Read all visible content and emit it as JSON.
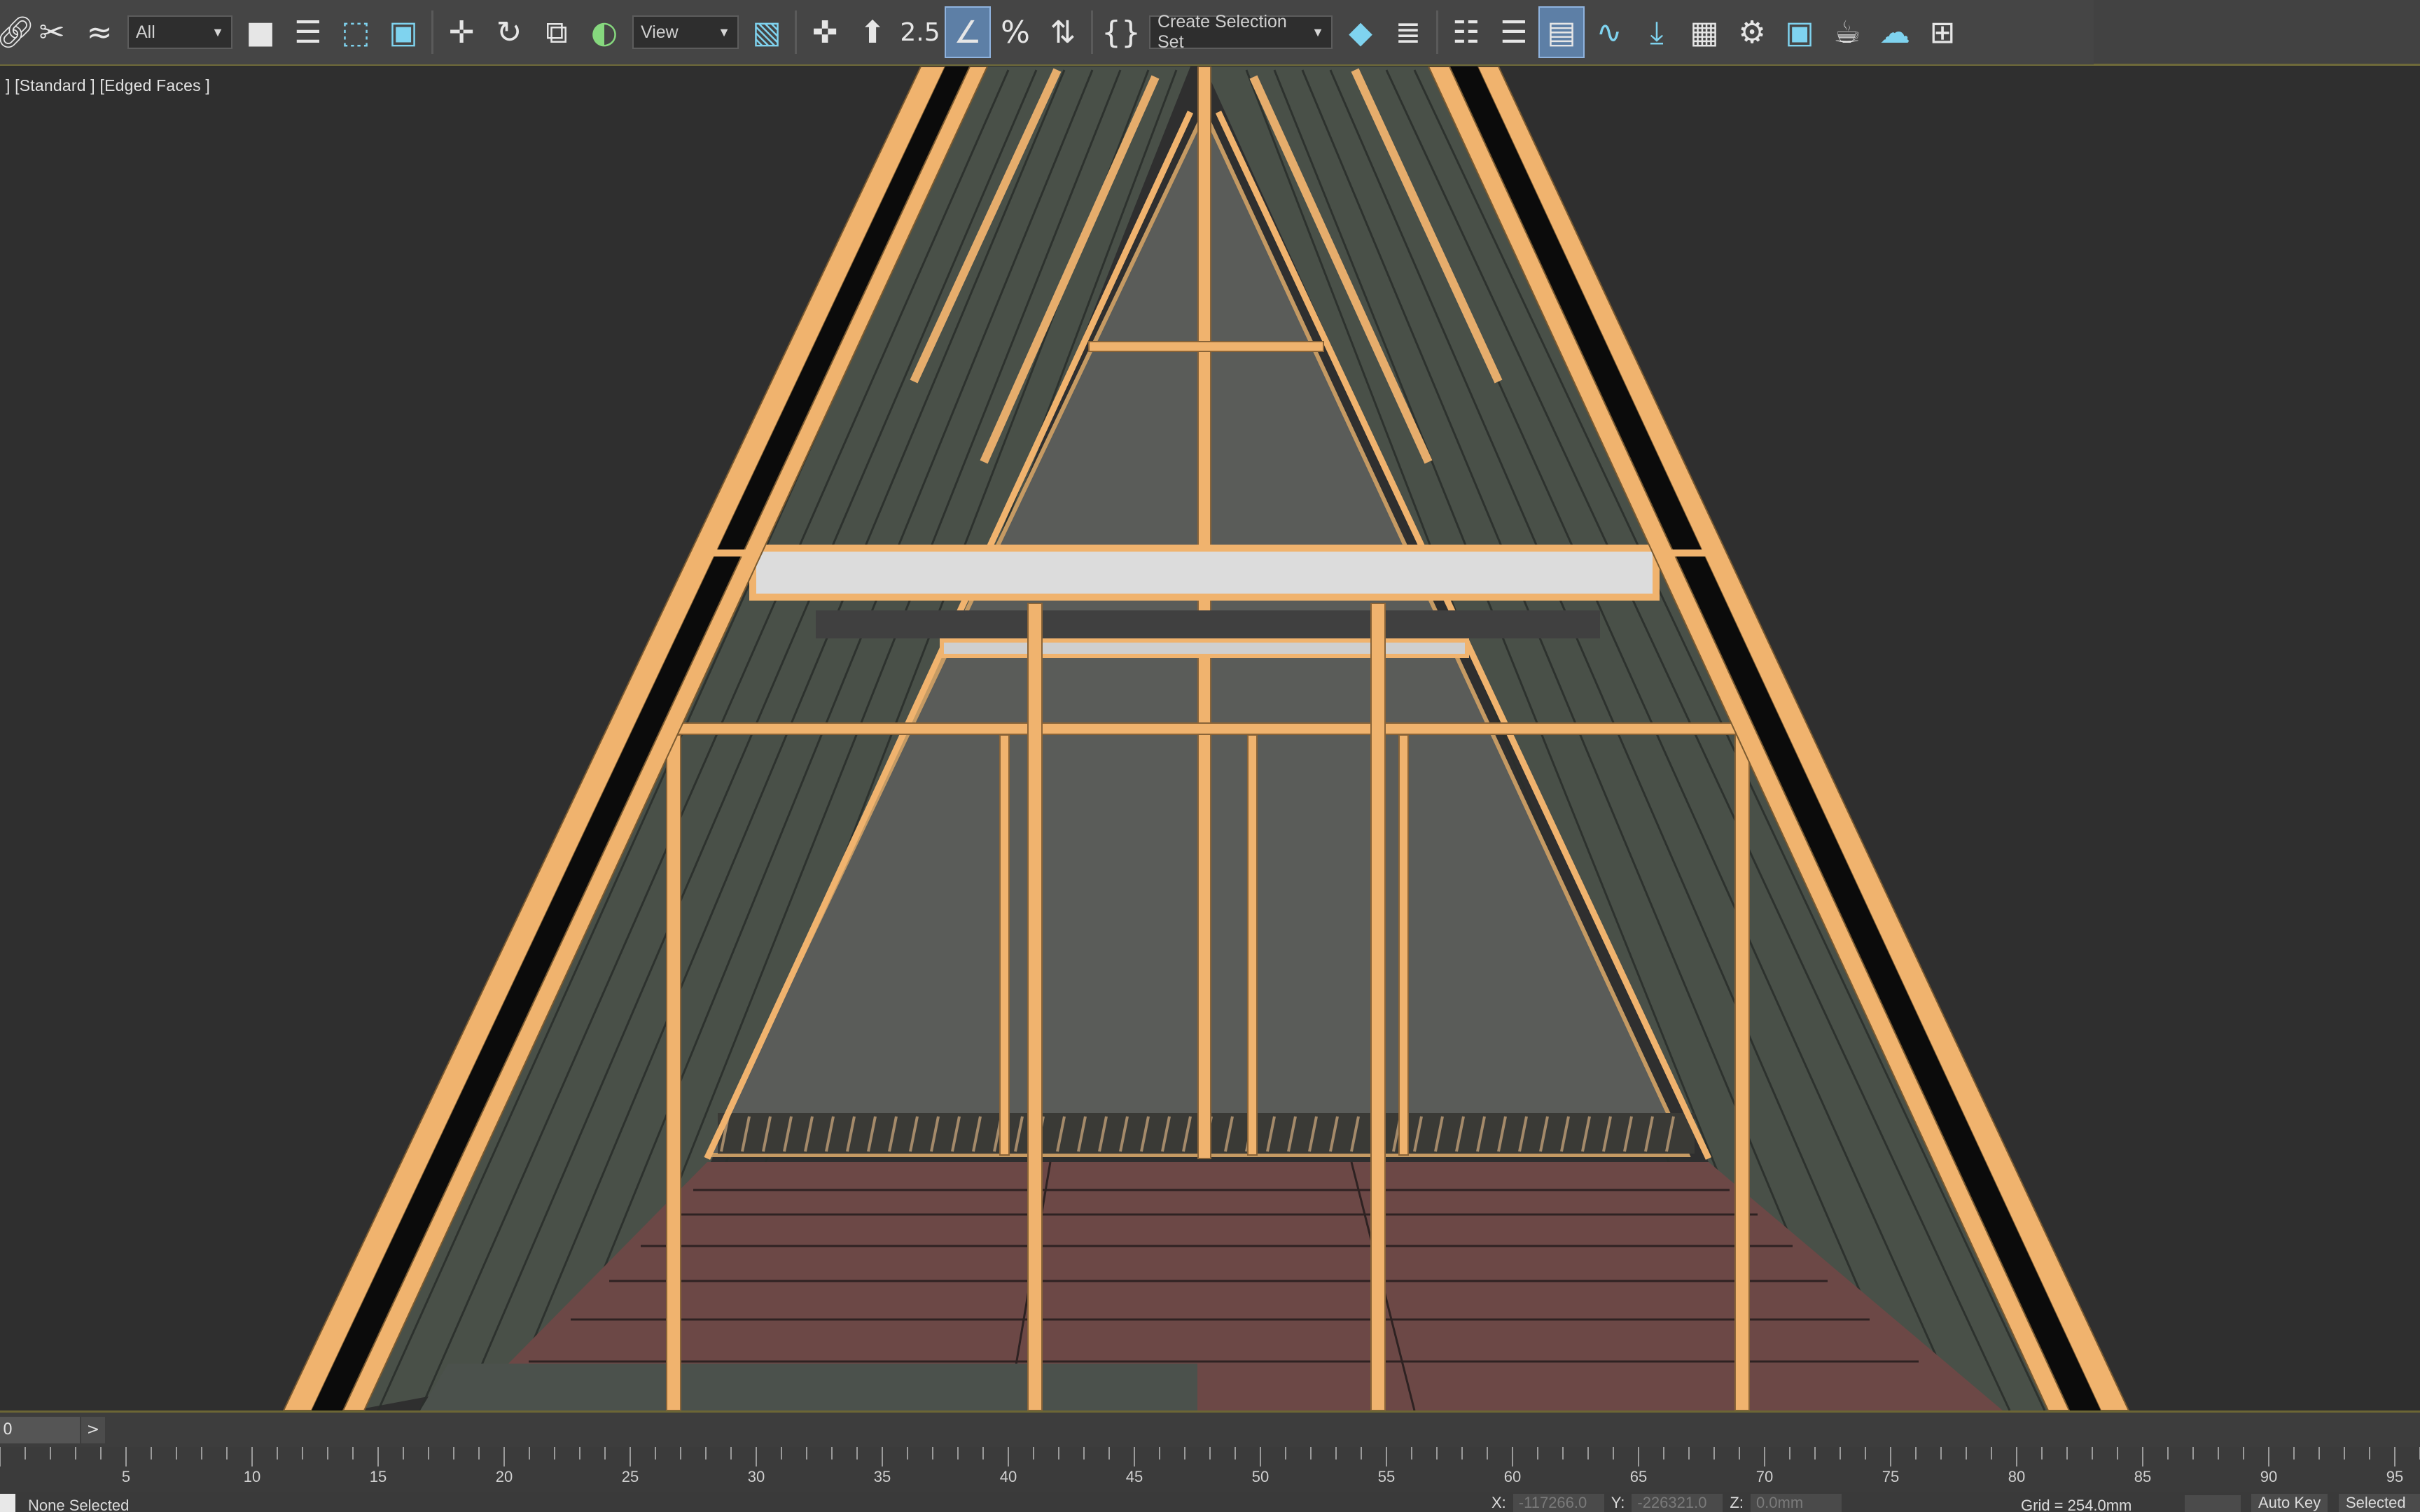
{
  "toolbar": {
    "filter_dropdown": "All",
    "ref_coord_dropdown": "View",
    "selection_set_dropdown": "Create Selection Set",
    "snap_label": "2.5",
    "icons": [
      "link-icon",
      "unlink-icon",
      "bind-space-warp-icon",
      "select-object-icon",
      "select-by-name-icon",
      "rect-selection-icon",
      "window-crossing-icon",
      "move-icon",
      "rotate-icon",
      "scale-icon",
      "place-icon",
      "pivot-icon",
      "manipulate-icon",
      "keyboard-shortcut-icon",
      "snaps-toggle-icon",
      "angle-snap-icon",
      "percent-snap-icon",
      "spinner-snap-icon",
      "edit-named-sel-icon",
      "mirror-icon",
      "align-icon",
      "scene-explorer-icon",
      "layer-explorer-icon",
      "ribbon-icon",
      "curve-editor-icon",
      "schematic-view-icon",
      "material-editor-icon",
      "render-setup-icon",
      "rendered-frame-icon",
      "render-icon",
      "render-cloud-icon",
      "render-iterative-icon",
      "viewport-layout-icon"
    ]
  },
  "viewport": {
    "label": "] [Standard ] [Edged Faces ]"
  },
  "timeslider": {
    "frame": "0",
    "next": ">"
  },
  "ruler": {
    "ticks": [
      "5",
      "10",
      "15",
      "20",
      "25",
      "30",
      "35",
      "40",
      "45",
      "50",
      "55",
      "60",
      "65",
      "70",
      "75",
      "80",
      "85",
      "90",
      "95"
    ]
  },
  "statusbar": {
    "selection_status": "None Selected",
    "x_label": "X:",
    "x_value": "-117266.0",
    "y_label": "Y:",
    "y_value": "-226321.0",
    "z_label": "Z:",
    "z_value": "0.0mm",
    "grid": "Grid = 254.0mm",
    "auto_key": "Auto Key",
    "selected": "Selected"
  },
  "colors": {
    "wood": "#f0b36e",
    "wall": "#4a514d",
    "window": "#595b58",
    "floor": "#6e4a48",
    "background": "#2f2f2f"
  }
}
